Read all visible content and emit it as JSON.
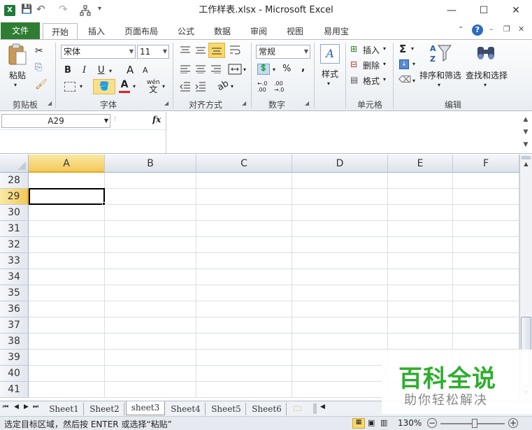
{
  "window": {
    "title": "工作样表.xlsx - Microsoft Excel",
    "minimize": "—",
    "restore": "☐",
    "close": "✕"
  },
  "quick_access": {
    "save": "💾",
    "undo": "↶",
    "redo": "↷",
    "more": "▾"
  },
  "tabs": [
    "文件",
    "开始",
    "插入",
    "页面布局",
    "公式",
    "数据",
    "审阅",
    "视图",
    "易用宝"
  ],
  "ribbon": {
    "clipboard": {
      "label": "剪贴板",
      "paste": "粘贴"
    },
    "font": {
      "label": "字体",
      "name": "宋体",
      "size": "11",
      "bold": "B",
      "italic": "I",
      "underline": "U",
      "grow": "A",
      "shrink": "A",
      "font_color": "A",
      "phonetic": "wén"
    },
    "alignment": {
      "label": "对齐方式"
    },
    "number": {
      "label": "数字",
      "format": "常规",
      "percent": "%",
      "comma": ",",
      "inc_decimal": "←.0\n.00",
      "dec_decimal": ".00\n→.0"
    },
    "styles": {
      "label": "样式",
      "styles_btn": "样式"
    },
    "cells": {
      "label": "单元格",
      "insert": "插入",
      "delete": "删除",
      "format": "格式"
    },
    "editing": {
      "label": "编辑",
      "sum": "Σ",
      "sort_filter": "排序和筛选",
      "find_select": "查找和选择"
    }
  },
  "formula_bar": {
    "name_box": "A29",
    "fx": "fx",
    "value": ""
  },
  "grid": {
    "columns": [
      "A",
      "B",
      "C",
      "D",
      "E",
      "F"
    ],
    "rows": [
      "28",
      "29",
      "30",
      "31",
      "32",
      "33",
      "34",
      "35",
      "36",
      "37",
      "38",
      "39",
      "40",
      "41"
    ],
    "active_cell": "A29"
  },
  "sheets": [
    "Sheet1",
    "Sheet2",
    "sheet3",
    "Sheet4",
    "Sheet5",
    "Sheet6"
  ],
  "active_sheet": "sheet3",
  "status": {
    "message": "选定目标区域，然后按 ENTER 或选择“粘贴”",
    "zoom": "130%"
  },
  "watermark": {
    "title": "百科全说",
    "subtitle": "助你轻松解决"
  },
  "colors": {
    "file_tab": "#2f7d32",
    "active_header": "#f8d86a",
    "watermark_green": "#2eae2e"
  }
}
